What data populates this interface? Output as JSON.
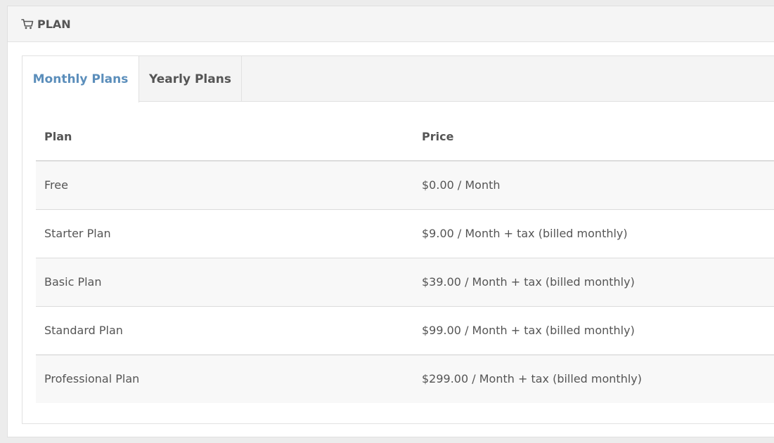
{
  "panel": {
    "title": "PLAN",
    "icon": "cart-icon"
  },
  "tabs": [
    {
      "label": "Monthly Plans",
      "active": true
    },
    {
      "label": "Yearly Plans",
      "active": false
    }
  ],
  "table": {
    "headers": {
      "plan": "Plan",
      "price": "Price"
    },
    "rows": [
      {
        "plan": "Free",
        "price": "$0.00 / Month"
      },
      {
        "plan": "Starter Plan",
        "price": "$9.00 / Month + tax (billed monthly)"
      },
      {
        "plan": "Basic Plan",
        "price": "$39.00 / Month + tax (billed monthly)"
      },
      {
        "plan": "Standard Plan",
        "price": "$99.00 / Month + tax (billed monthly)"
      },
      {
        "plan": "Professional Plan",
        "price": "$299.00 / Month + tax (billed monthly)"
      }
    ]
  },
  "colors": {
    "active_tab": "#5b8ebb",
    "text": "#555555"
  }
}
